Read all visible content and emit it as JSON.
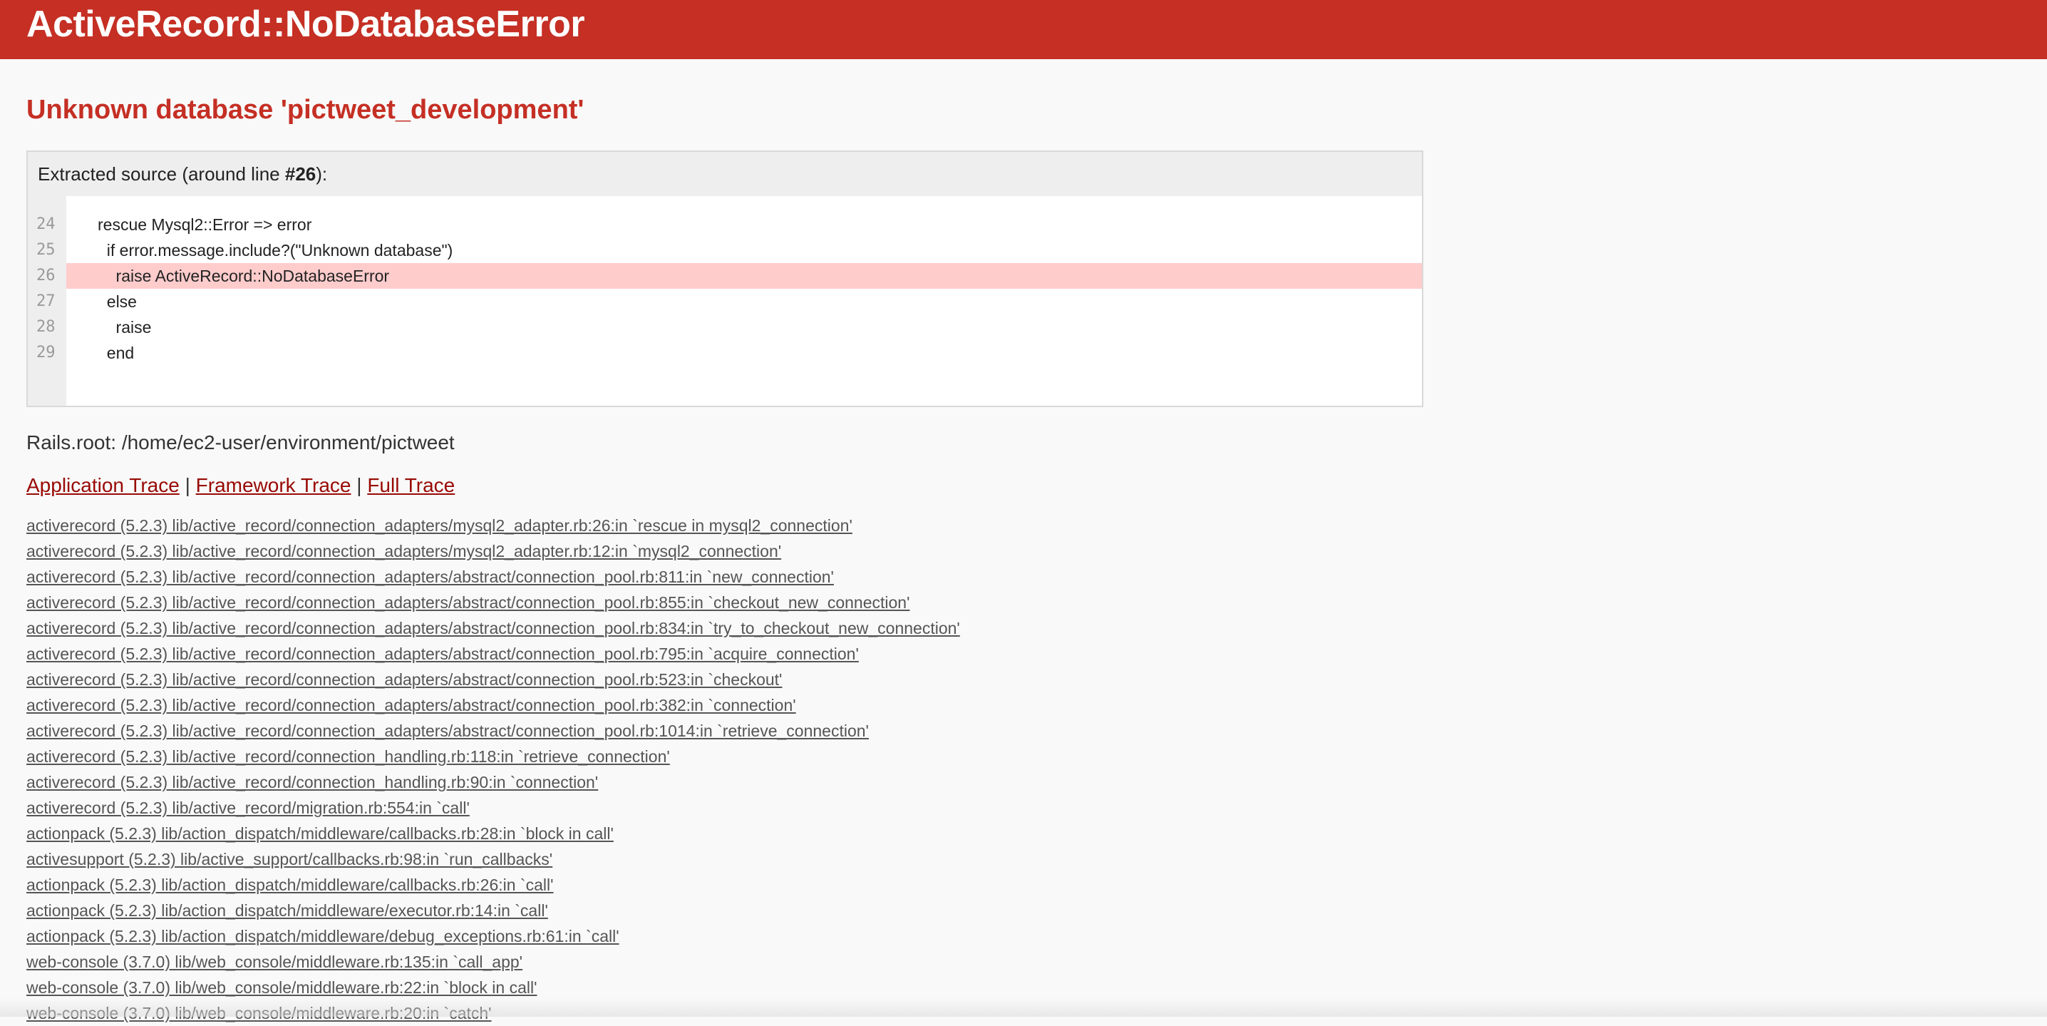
{
  "header": {
    "title": "ActiveRecord::NoDatabaseError"
  },
  "error_message": "Unknown database 'pictweet_development'",
  "source": {
    "header_prefix": "Extracted source (around line ",
    "header_line": "#26",
    "header_suffix": "):",
    "line_numbers": [
      "24",
      "25",
      "26",
      "27",
      "28",
      "29"
    ],
    "lines": [
      "rescue Mysql2::Error => error",
      "  if error.message.include?(\"Unknown database\")",
      "    raise ActiveRecord::NoDatabaseError",
      "  else",
      "    raise",
      "  end"
    ]
  },
  "rails_root": "Rails.root: /home/ec2-user/environment/pictweet",
  "trace_links": {
    "application": "Application Trace",
    "framework": "Framework Trace",
    "full": "Full Trace",
    "separator": "|"
  },
  "traces": [
    "activerecord (5.2.3) lib/active_record/connection_adapters/mysql2_adapter.rb:26:in `rescue in mysql2_connection'",
    "activerecord (5.2.3) lib/active_record/connection_adapters/mysql2_adapter.rb:12:in `mysql2_connection'",
    "activerecord (5.2.3) lib/active_record/connection_adapters/abstract/connection_pool.rb:811:in `new_connection'",
    "activerecord (5.2.3) lib/active_record/connection_adapters/abstract/connection_pool.rb:855:in `checkout_new_connection'",
    "activerecord (5.2.3) lib/active_record/connection_adapters/abstract/connection_pool.rb:834:in `try_to_checkout_new_connection'",
    "activerecord (5.2.3) lib/active_record/connection_adapters/abstract/connection_pool.rb:795:in `acquire_connection'",
    "activerecord (5.2.3) lib/active_record/connection_adapters/abstract/connection_pool.rb:523:in `checkout'",
    "activerecord (5.2.3) lib/active_record/connection_adapters/abstract/connection_pool.rb:382:in `connection'",
    "activerecord (5.2.3) lib/active_record/connection_adapters/abstract/connection_pool.rb:1014:in `retrieve_connection'",
    "activerecord (5.2.3) lib/active_record/connection_handling.rb:118:in `retrieve_connection'",
    "activerecord (5.2.3) lib/active_record/connection_handling.rb:90:in `connection'",
    "activerecord (5.2.3) lib/active_record/migration.rb:554:in `call'",
    "actionpack (5.2.3) lib/action_dispatch/middleware/callbacks.rb:28:in `block in call'",
    "activesupport (5.2.3) lib/active_support/callbacks.rb:98:in `run_callbacks'",
    "actionpack (5.2.3) lib/action_dispatch/middleware/callbacks.rb:26:in `call'",
    "actionpack (5.2.3) lib/action_dispatch/middleware/executor.rb:14:in `call'",
    "actionpack (5.2.3) lib/action_dispatch/middleware/debug_exceptions.rb:61:in `call'",
    "web-console (3.7.0) lib/web_console/middleware.rb:135:in `call_app'",
    "web-console (3.7.0) lib/web_console/middleware.rb:22:in `block in call'",
    "web-console (3.7.0) lib/web_console/middleware.rb:20:in `catch'"
  ],
  "colors": {
    "header_bg": "#c52f24",
    "message": "#c52f24",
    "highlight_line": "#ffcccc",
    "trace_link": "#980905"
  }
}
